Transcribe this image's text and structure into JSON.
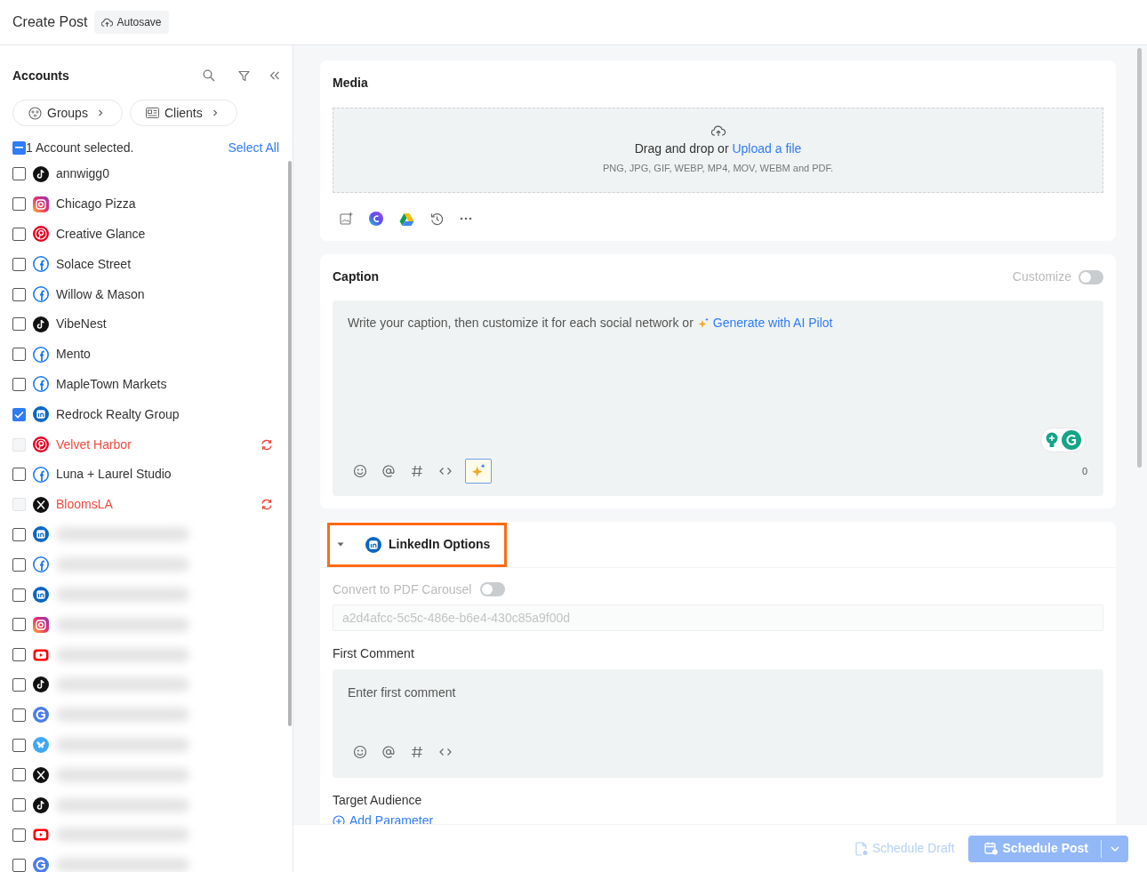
{
  "header": {
    "title": "Create Post",
    "autosave": "Autosave"
  },
  "accounts_panel": {
    "title": "Accounts",
    "filters": [
      {
        "kind": "groups",
        "label": "Groups"
      },
      {
        "kind": "clients",
        "label": "Clients"
      }
    ],
    "summary": {
      "checked": true,
      "partial": true,
      "text": "1 Account selected.",
      "select_all": "Select All"
    },
    "accounts": [
      {
        "name": "annwigg0",
        "kind": "tiktok",
        "checked": false,
        "error": false
      },
      {
        "name": "Chicago Pizza",
        "kind": "instagram",
        "checked": false,
        "error": false
      },
      {
        "name": "Creative Glance",
        "kind": "pinterest",
        "checked": false,
        "error": false
      },
      {
        "name": "Solace Street",
        "kind": "facebook",
        "checked": false,
        "error": false
      },
      {
        "name": "Willow & Mason",
        "kind": "facebook",
        "checked": false,
        "error": false
      },
      {
        "name": "VibeNest",
        "kind": "tiktok",
        "checked": false,
        "error": false
      },
      {
        "name": "Mento",
        "kind": "facebook",
        "checked": false,
        "error": false
      },
      {
        "name": "MapleTown Markets",
        "kind": "facebook",
        "checked": false,
        "error": false
      },
      {
        "name": "Redrock Realty Group",
        "kind": "linkedin",
        "checked": true,
        "error": false
      },
      {
        "name": "Velvet Harbor",
        "kind": "pinterest",
        "checked": false,
        "error": true
      },
      {
        "name": "Luna + Laurel Studio",
        "kind": "facebook",
        "checked": false,
        "error": false
      },
      {
        "name": "BloomsLA",
        "kind": "x",
        "checked": false,
        "error": true
      },
      {
        "kind": "linkedin",
        "checked": false
      },
      {
        "kind": "facebook",
        "checked": false
      },
      {
        "kind": "linkedin",
        "checked": false
      },
      {
        "kind": "instagram",
        "checked": false
      },
      {
        "kind": "youtube",
        "checked": false
      },
      {
        "kind": "tiktok",
        "checked": false
      },
      {
        "kind": "google",
        "checked": false
      },
      {
        "kind": "bluesky",
        "checked": false
      },
      {
        "kind": "x",
        "checked": false
      },
      {
        "kind": "tiktok",
        "checked": false
      },
      {
        "kind": "youtube",
        "checked": false
      },
      {
        "kind": "google",
        "checked": false
      }
    ]
  },
  "media": {
    "title": "Media",
    "drop_text": "Drag and drop or",
    "upload_link": "Upload a file",
    "formats": "PNG, JPG, GIF, WEBP, MP4, MOV, WEBM and PDF."
  },
  "caption": {
    "title": "Caption",
    "customize": {
      "label": "Customize",
      "on": false
    },
    "placeholder": "Write your caption, then customize it for each social network or",
    "ai_link": "Generate with AI Pilot",
    "count": "0"
  },
  "linkedin_options": {
    "title": "LinkedIn Options",
    "expanded": true,
    "convert": {
      "label": "Convert to PDF Carousel",
      "on": false
    },
    "id_field": "a2d4afcc-5c5c-486e-b6e4-430c85a9f00d",
    "first_comment": {
      "label": "First Comment",
      "placeholder": "Enter first comment"
    },
    "target_audience": {
      "label": "Target Audience",
      "link": "Add Parameter"
    }
  },
  "footer": {
    "draft": "Schedule Draft",
    "schedule": "Schedule Post"
  }
}
